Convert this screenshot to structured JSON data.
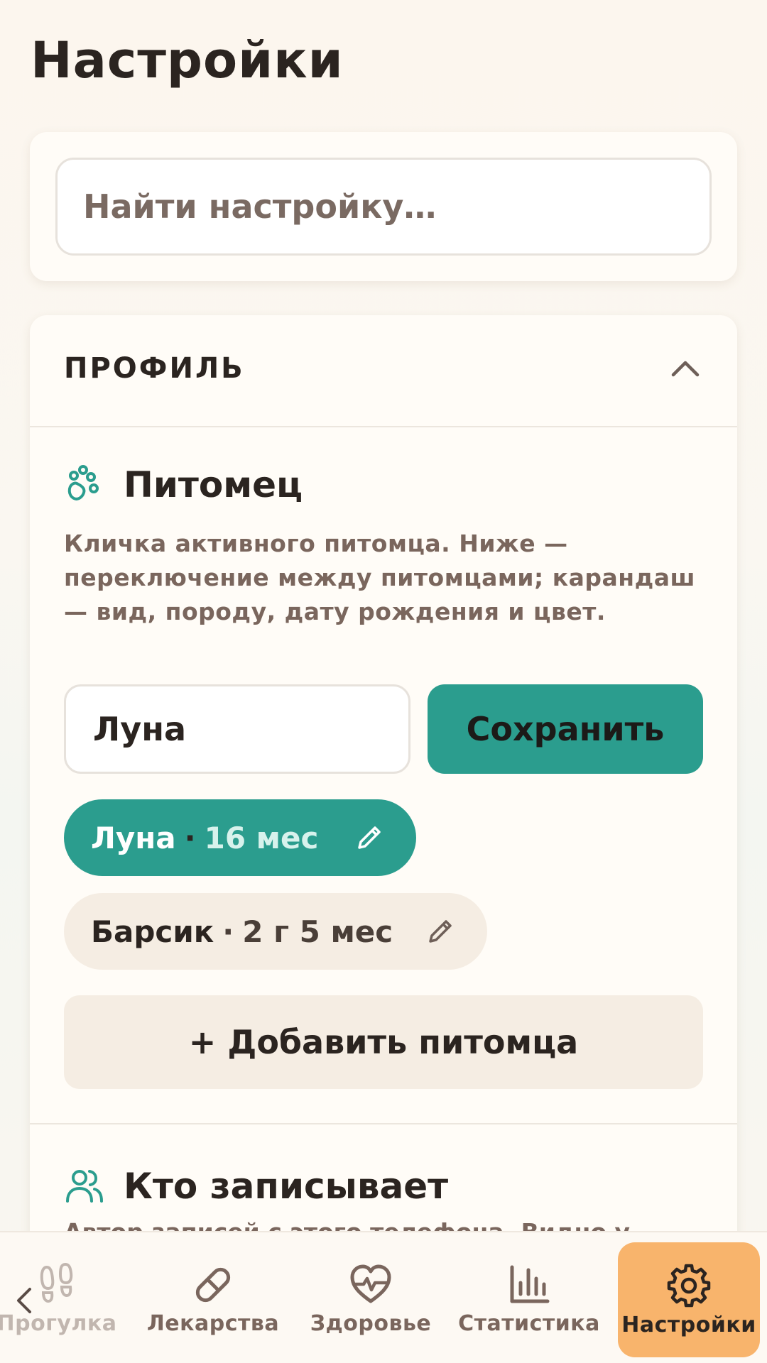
{
  "page": {
    "title": "Настройки"
  },
  "search": {
    "placeholder": "Найти настройку…"
  },
  "profile_section": {
    "title": "ПРОФИЛЬ",
    "pet": {
      "title": "Питомец",
      "description": "Кличка активного питомца. Ниже — переключение между питомцами; карандаш — вид, породу, дату рождения и цвет.",
      "name_value": "Луна",
      "save_label": "Сохранить",
      "pets": [
        {
          "name": "Луна",
          "separator": "·",
          "age": "16 мес",
          "active": true
        },
        {
          "name": "Барсик",
          "separator": "·",
          "age": "2 г 5 мес",
          "active": false
        }
      ],
      "add_label": "+ Добавить питомца"
    },
    "who_records": {
      "title": "Кто записывает",
      "description_partial": "Автор записей с этого телефона. Видно у"
    }
  },
  "bottom_nav": {
    "items": [
      {
        "label": "Прогулка",
        "icon": "footprints-icon"
      },
      {
        "label": "Лекарства",
        "icon": "pill-icon"
      },
      {
        "label": "Здоровье",
        "icon": "heart-pulse-icon"
      },
      {
        "label": "Статистика",
        "icon": "bar-chart-icon"
      },
      {
        "label": "Настройки",
        "icon": "gear-icon",
        "active": true
      }
    ]
  },
  "colors": {
    "accent_teal": "#2b9d8e",
    "active_nav": "#f8b46c",
    "chip_inactive": "#f5ede3",
    "text_dark": "#2b2420",
    "text_muted": "#7a665d"
  }
}
